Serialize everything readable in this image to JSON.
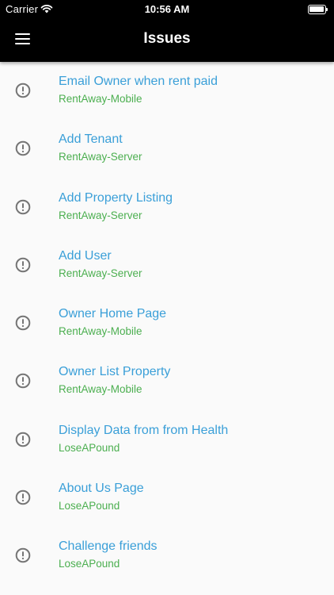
{
  "status_bar": {
    "carrier": "Carrier",
    "time": "10:56 AM"
  },
  "header": {
    "title": "Issues",
    "menu_icon": "hamburger-menu-icon"
  },
  "colors": {
    "header_bg": "#000000",
    "title_color": "#3a9fd8",
    "subtitle_color": "#4caf50",
    "icon_color": "#757575",
    "background": "#fafafa"
  },
  "issues": [
    {
      "title": "Email Owner when rent paid",
      "project": "RentAway-Mobile",
      "icon": "alert-circle-icon"
    },
    {
      "title": "Add Tenant",
      "project": "RentAway-Server",
      "icon": "alert-circle-icon"
    },
    {
      "title": "Add Property Listing",
      "project": "RentAway-Server",
      "icon": "alert-circle-icon"
    },
    {
      "title": "Add User",
      "project": "RentAway-Server",
      "icon": "alert-circle-icon"
    },
    {
      "title": "Owner Home Page",
      "project": "RentAway-Mobile",
      "icon": "alert-circle-icon"
    },
    {
      "title": "Owner List Property",
      "project": "RentAway-Mobile",
      "icon": "alert-circle-icon"
    },
    {
      "title": "Display Data from from Health",
      "project": "LoseAPound",
      "icon": "alert-circle-icon"
    },
    {
      "title": "About Us Page",
      "project": "LoseAPound",
      "icon": "alert-circle-icon"
    },
    {
      "title": "Challenge friends",
      "project": "LoseAPound",
      "icon": "alert-circle-icon"
    }
  ]
}
